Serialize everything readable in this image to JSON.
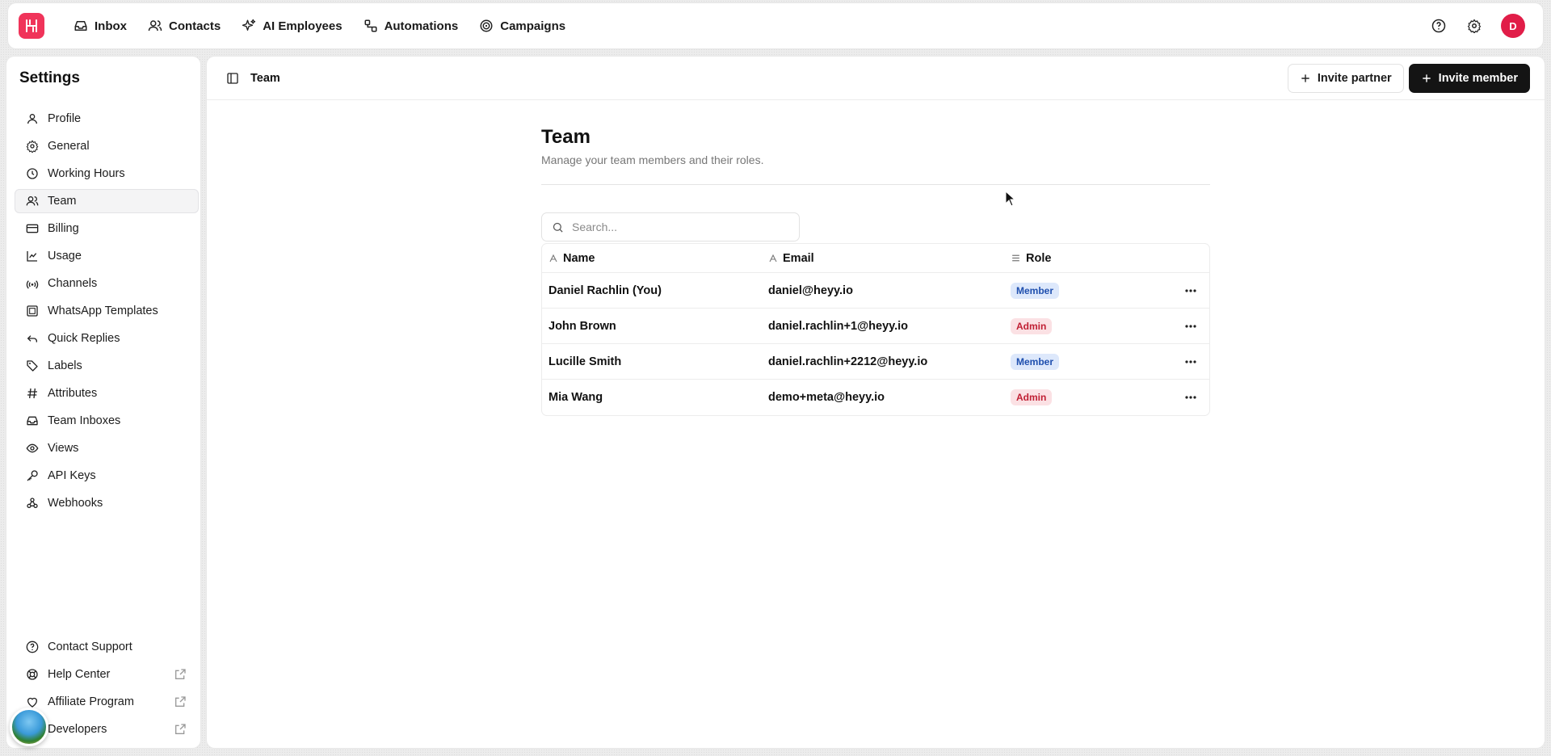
{
  "nav": {
    "items": [
      {
        "label": "Inbox",
        "icon": "inbox-icon"
      },
      {
        "label": "Contacts",
        "icon": "contacts-icon"
      },
      {
        "label": "AI Employees",
        "icon": "sparkles-icon"
      },
      {
        "label": "Automations",
        "icon": "workflow-icon"
      },
      {
        "label": "Campaigns",
        "icon": "target-icon"
      }
    ],
    "avatar_initial": "D"
  },
  "sidebar": {
    "title": "Settings",
    "items": [
      {
        "label": "Profile"
      },
      {
        "label": "General"
      },
      {
        "label": "Working Hours"
      },
      {
        "label": "Team"
      },
      {
        "label": "Billing"
      },
      {
        "label": "Usage"
      },
      {
        "label": "Channels"
      },
      {
        "label": "WhatsApp Templates"
      },
      {
        "label": "Quick Replies"
      },
      {
        "label": "Labels"
      },
      {
        "label": "Attributes"
      },
      {
        "label": "Team Inboxes"
      },
      {
        "label": "Views"
      },
      {
        "label": "API Keys"
      },
      {
        "label": "Webhooks"
      }
    ],
    "footer": [
      {
        "label": "Contact Support"
      },
      {
        "label": "Help Center"
      },
      {
        "label": "Affiliate Program"
      },
      {
        "label": "Developers"
      }
    ]
  },
  "header": {
    "breadcrumb": "Team",
    "invite_partner": "Invite partner",
    "invite_member": "Invite member"
  },
  "page": {
    "title": "Team",
    "subtitle": "Manage your team members and their roles.",
    "search_placeholder": "Search..."
  },
  "table": {
    "columns": {
      "name": "Name",
      "email": "Email",
      "role": "Role"
    },
    "rows": [
      {
        "name": "Daniel Rachlin (You)",
        "email": "daniel@heyy.io",
        "role": "Member"
      },
      {
        "name": "John Brown",
        "email": "daniel.rachlin+1@heyy.io",
        "role": "Admin"
      },
      {
        "name": "Lucille Smith",
        "email": "daniel.rachlin+2212@heyy.io",
        "role": "Member"
      },
      {
        "name": "Mia Wang",
        "email": "demo+meta@heyy.io",
        "role": "Admin"
      }
    ]
  },
  "colors": {
    "brand": "#f0345a",
    "member_badge": "#dde8fb",
    "admin_badge": "#fbe1e4"
  }
}
